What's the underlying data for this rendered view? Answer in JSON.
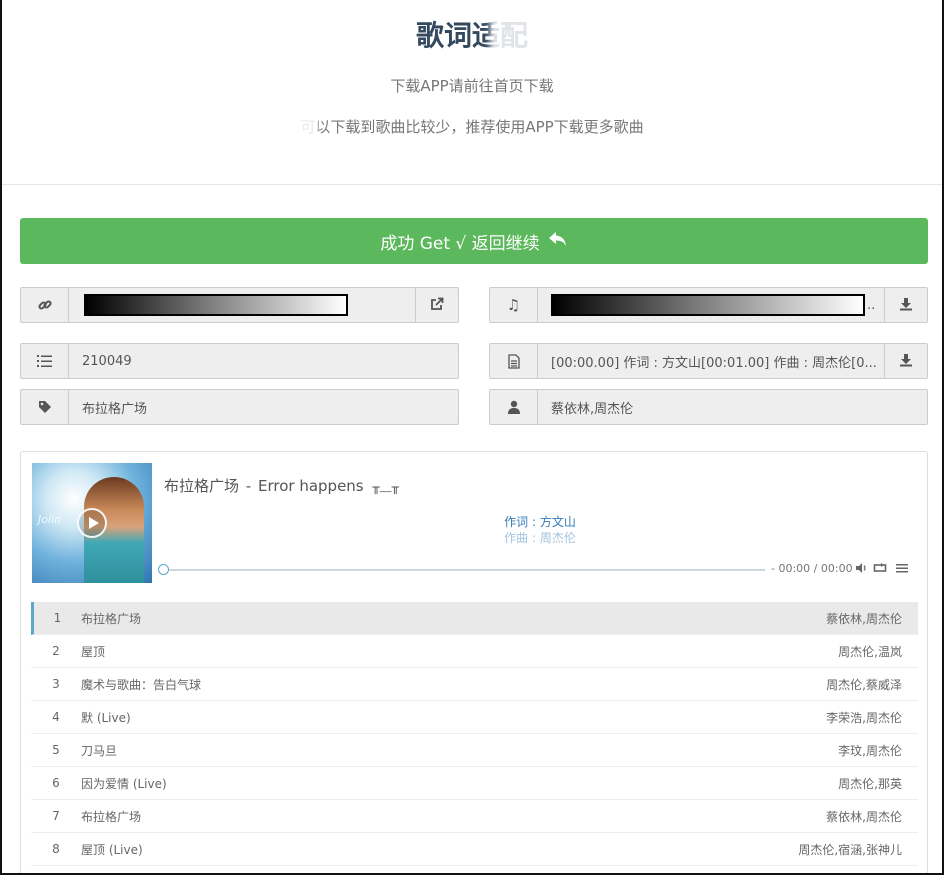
{
  "header": {
    "title": "歌词适配",
    "subtitle1": "下载APP请前往首页下载",
    "subtitle2": "可以下载到歌曲比较少，推荐使用APP下载更多歌曲"
  },
  "success_button": {
    "label": "成功 Get √ 返回继续",
    "icon": "reply-icon",
    "color": "#5cb85c"
  },
  "fields": {
    "link": {
      "icon": "link-icon",
      "value": "",
      "action_icon": "external-link-icon"
    },
    "music": {
      "icon": "music-icon",
      "value": "",
      "action_icon": "download-icon"
    },
    "song_id": {
      "icon": "list-icon",
      "value": "210049"
    },
    "lyrics": {
      "icon": "file-text-icon",
      "value": "[00:00.00] 作词 : 方文山[00:01.00] 作曲 : 周杰伦[0...",
      "action_icon": "download-icon"
    },
    "song_name": {
      "icon": "tag-icon",
      "value": "布拉格广场"
    },
    "artist": {
      "icon": "user-icon",
      "value": "蔡依林,周杰伦"
    }
  },
  "player": {
    "title": "布拉格广场",
    "separator": "-",
    "status": "Error happens",
    "emote": "╥﹏╥",
    "lyric_line1": "作词 : 方文山",
    "lyric_line2": "作曲 : 周杰伦",
    "time": "- 00:00 / 00:00",
    "progress": 0,
    "accent": "#5aa9c9"
  },
  "playlist": [
    {
      "num": "1",
      "name": "布拉格广场",
      "artist": "蔡依林,周杰伦"
    },
    {
      "num": "2",
      "name": "屋顶",
      "artist": "周杰伦,温岚"
    },
    {
      "num": "3",
      "name": "魔术与歌曲：告白气球",
      "artist": "周杰伦,蔡威泽"
    },
    {
      "num": "4",
      "name": "默 (Live)",
      "artist": "李荣浩,周杰伦"
    },
    {
      "num": "5",
      "name": "刀马旦",
      "artist": "李玟,周杰伦"
    },
    {
      "num": "6",
      "name": "因为爱情 (Live)",
      "artist": "周杰伦,那英"
    },
    {
      "num": "7",
      "name": "布拉格广场",
      "artist": "蔡依林,周杰伦"
    },
    {
      "num": "8",
      "name": "屋顶 (Live)",
      "artist": "周杰伦,宿涵,张神儿"
    }
  ]
}
